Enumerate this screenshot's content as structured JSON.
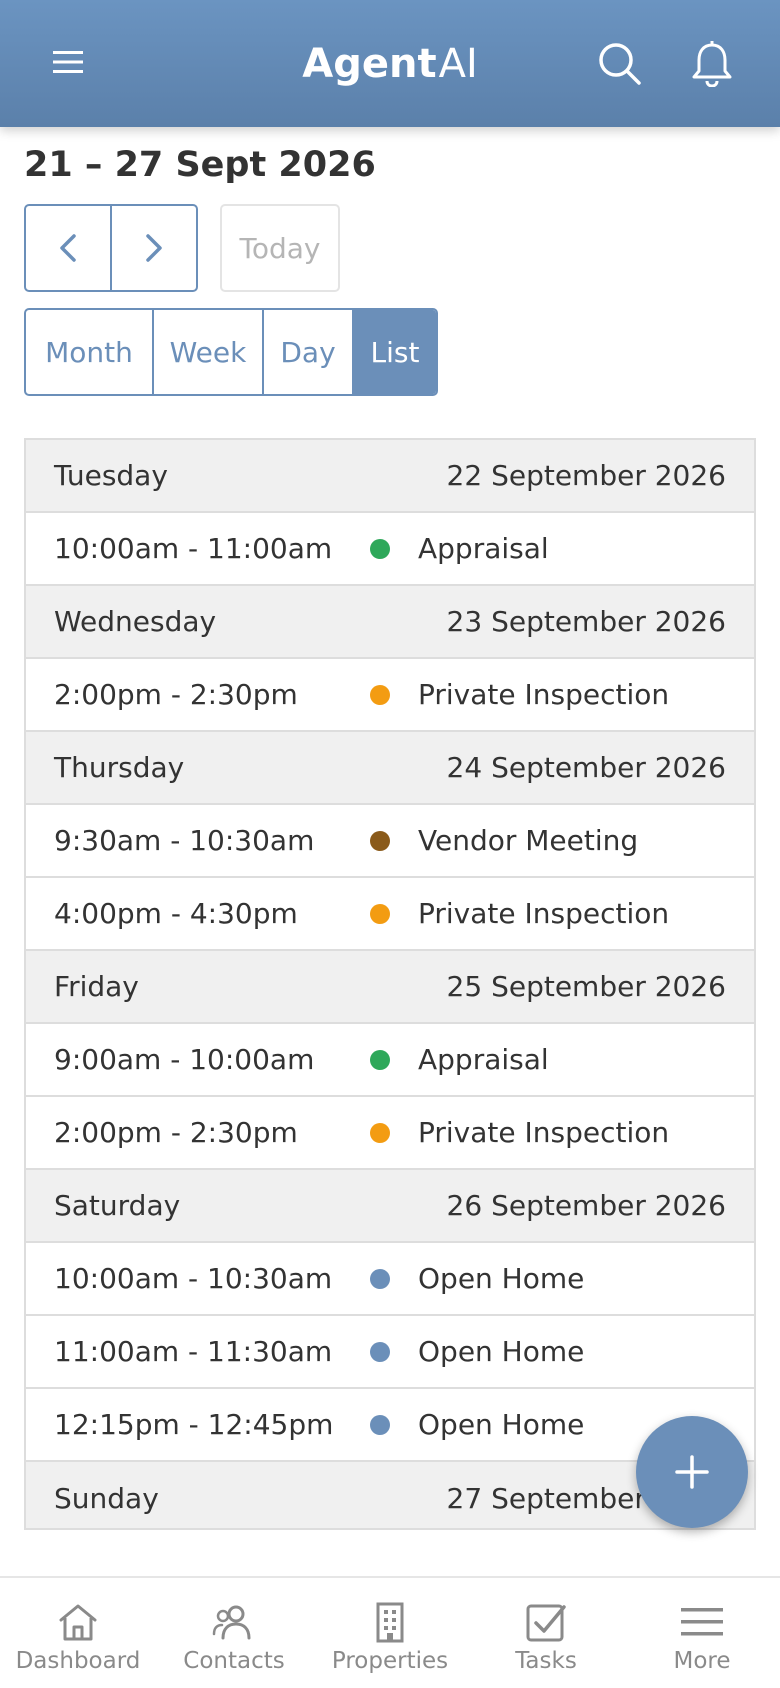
{
  "header": {
    "logo_bold": "Agent",
    "logo_light": "AI",
    "menu_icon": "hamburger-icon",
    "search_icon": "search-icon",
    "notification_icon": "bell-icon"
  },
  "calendar": {
    "range_title": "21 – 27 Sept 2026",
    "today_label": "Today",
    "views": [
      "Month",
      "Week",
      "Day",
      "List"
    ],
    "active_view": "List"
  },
  "schedule": [
    {
      "day": "Tuesday",
      "date": "22 September 2026",
      "events": [
        {
          "time": "10:00am - 11:00am",
          "title": "Appraisal",
          "color": "#2ea85a"
        }
      ]
    },
    {
      "day": "Wednesday",
      "date": "23 September 2026",
      "events": [
        {
          "time": "2:00pm - 2:30pm",
          "title": "Private Inspection",
          "color": "#f39c12"
        }
      ]
    },
    {
      "day": "Thursday",
      "date": "24 September 2026",
      "events": [
        {
          "time": "9:30am - 10:30am",
          "title": "Vendor Meeting",
          "color": "#8a5a1a"
        },
        {
          "time": "4:00pm - 4:30pm",
          "title": "Private Inspection",
          "color": "#f39c12"
        }
      ]
    },
    {
      "day": "Friday",
      "date": "25 September 2026",
      "events": [
        {
          "time": "9:00am - 10:00am",
          "title": "Appraisal",
          "color": "#2ea85a"
        },
        {
          "time": "2:00pm - 2:30pm",
          "title": "Private Inspection",
          "color": "#f39c12"
        }
      ]
    },
    {
      "day": "Saturday",
      "date": "26 September 2026",
      "events": [
        {
          "time": "10:00am - 10:30am",
          "title": "Open Home",
          "color": "#6b8fb9"
        },
        {
          "time": "11:00am - 11:30am",
          "title": "Open Home",
          "color": "#6b8fb9"
        },
        {
          "time": "12:15pm - 12:45pm",
          "title": "Open Home",
          "color": "#6b8fb9"
        }
      ]
    },
    {
      "day": "Sunday",
      "date": "27 September 2026",
      "events": []
    }
  ],
  "fab": {
    "icon": "plus-icon"
  },
  "bottom_nav": [
    {
      "label": "Dashboard",
      "icon": "home-icon"
    },
    {
      "label": "Contacts",
      "icon": "contacts-icon"
    },
    {
      "label": "Properties",
      "icon": "building-icon"
    },
    {
      "label": "Tasks",
      "icon": "checkbox-icon"
    },
    {
      "label": "More",
      "icon": "menu-icon"
    }
  ],
  "colors": {
    "brand": "#6b8fb9",
    "header": "#6b94c1",
    "day_row_bg": "#f0f0f0"
  }
}
